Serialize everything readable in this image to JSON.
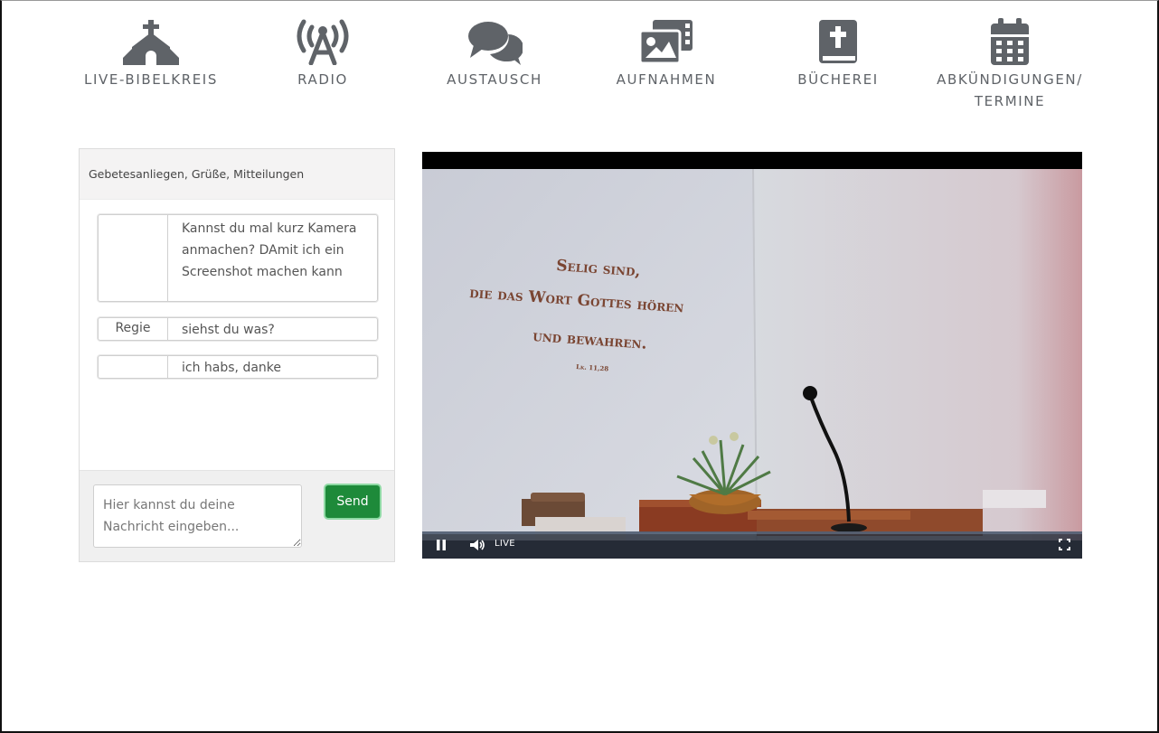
{
  "nav": {
    "items": [
      {
        "label": "LIVE-BIBELKREIS",
        "icon": "church-icon"
      },
      {
        "label": "RADIO",
        "icon": "radio-tower-icon"
      },
      {
        "label": "AUSTAUSCH",
        "icon": "chat-bubbles-icon"
      },
      {
        "label": "AUFNAHMEN",
        "icon": "photo-video-icon"
      },
      {
        "label": "BÜCHEREI",
        "icon": "bible-icon"
      },
      {
        "label_line1": "ABKÜNDIGUNGEN/",
        "label_line2": "TERMINE",
        "icon": "calendar-icon"
      }
    ],
    "icon_color": "#5f6368"
  },
  "chat": {
    "header": "Gebetesanliegen, Grüße, Mitteilungen",
    "messages": [
      {
        "author": "",
        "text": "Kannst du mal kurz Kamera anmachen? DAmit ich ein Screenshot machen kann"
      },
      {
        "author": "Regie",
        "text": "siehst du was?"
      },
      {
        "author": "",
        "text": "ich habs, danke"
      }
    ],
    "input_placeholder": "Hier kannst du deine Nachricht eingeben...",
    "send_label": "Send",
    "send_color": "#1e8a3a"
  },
  "video": {
    "wall_text": {
      "line1": "Selig sind,",
      "line2": "die das Wort Gottes hören",
      "line3": "und bewahren.",
      "reference": "Lk. 11,28"
    },
    "live_label": "LIVE",
    "controls": {
      "play_state_icon": "pause-icon",
      "volume_icon": "volume-icon",
      "fullscreen_icon": "fullscreen-icon"
    }
  }
}
